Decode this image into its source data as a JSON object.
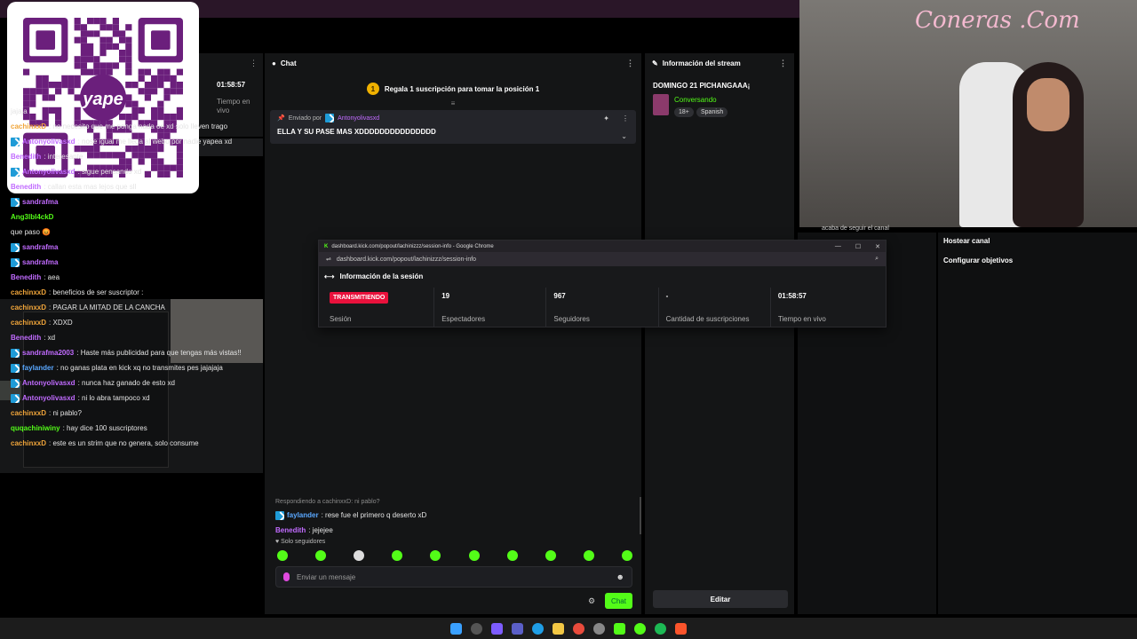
{
  "panels": {
    "chat_title": "Chat",
    "info_title": "Información del stream",
    "menu_glyph": "⋮"
  },
  "left_panel": {
    "time": "01:58:57",
    "label": "Tiempo en vivo"
  },
  "chat": {
    "promo": "Regala 1 suscripción para tomar la posición 1",
    "promo_rank": "1",
    "pinned_by_label": "Enviado por",
    "pinned_by_user": "Antonyolivasxd",
    "pinned_text": "ELLA Y SU PASE MAS XDDDDDDDDDDDDDDD",
    "messages": [
      {
        "user": "",
        "text": "jajaja",
        "color": "#e4e4e4",
        "badge": false
      },
      {
        "user": "cachinxxD",
        "text": ": no necesito que me ponga nada oe xd solo lleven trago",
        "color": "#f0a53a",
        "badge": false
      },
      {
        "user": "Antonyolivasxd",
        "text": ": nose igual me llega al webo por nadie yapea xd",
        "color": "#c16bff",
        "badge": true
      },
      {
        "user": "Benedith",
        "text": ": interesante",
        "color": "#c16bff",
        "badge": false
      },
      {
        "user": "Antonyolivasxd",
        "text": ": sigue pensando xd",
        "color": "#c16bff",
        "badge": true
      },
      {
        "user": "Benedith",
        "text": ": callan esta mas lejos que sll",
        "color": "#c16bff",
        "badge": false
      },
      {
        "user": "sandrafma",
        "text": "",
        "color": "#c16bff",
        "badge": true
      },
      {
        "user": "Ang3lbl4ckD",
        "text": "",
        "color": "#53fc18",
        "badge": false
      },
      {
        "user": "",
        "text": "que paso 😡",
        "color": "#e4e4e4",
        "badge": false
      },
      {
        "user": "sandrafma",
        "text": "",
        "color": "#c16bff",
        "badge": true
      },
      {
        "user": "sandrafma",
        "text": "",
        "color": "#c16bff",
        "badge": true
      },
      {
        "user": "Benedith",
        "text": ": aea",
        "color": "#c16bff",
        "badge": false
      },
      {
        "user": "cachinxxD",
        "text": ": beneficios de ser suscriptor :",
        "color": "#f0a53a",
        "badge": false
      },
      {
        "user": "cachinxxD",
        "text": ": PAGAR LA MITAD DE LA CANCHA",
        "color": "#f0a53a",
        "badge": false
      },
      {
        "user": "cachinxxD",
        "text": ": XDXD",
        "color": "#f0a53a",
        "badge": false
      },
      {
        "user": "Benedith",
        "text": ": xd",
        "color": "#c16bff",
        "badge": false
      },
      {
        "user": "sandrafma2003",
        "text": ": Haste más publicidad para que tengas más vistas!!",
        "color": "#c16bff",
        "badge": true
      },
      {
        "user": "faylander",
        "text": ": no ganas plata en kick xq no transmites pes jajajaja",
        "color": "#5aa8ff",
        "badge": true
      },
      {
        "user": "Antonyolivasxd",
        "text": ": nunca haz ganado de esto xd",
        "color": "#c16bff",
        "badge": true
      },
      {
        "user": "Antonyolivasxd",
        "text": ": ni lo abra tampoco xd",
        "color": "#c16bff",
        "badge": true
      },
      {
        "user": "cachinxxD",
        "text": ": ni pablo?",
        "color": "#f0a53a",
        "badge": false
      },
      {
        "user": "quqachiniwiny",
        "text": ": hay dice 100 suscriptores",
        "color": "#53fc18",
        "badge": false
      },
      {
        "user": "cachinxxD",
        "text": ": este es un strim que no genera, solo consume",
        "color": "#f0a53a",
        "badge": false
      }
    ],
    "reply_hint": "Respondiendo a cachinxxD: ni pablo?",
    "reply_msg": {
      "user": "faylander",
      "text": ": rese fue el primero q deserto xD",
      "color": "#5aa8ff"
    },
    "last_msg": {
      "user": "Benedith",
      "text": ": jejejee",
      "color": "#c16bff"
    },
    "follow_only": "♥ Solo seguidores",
    "input_placeholder": "Enviar un mensaje",
    "send_label": "Chat"
  },
  "stream_info": {
    "title": "DOMINGO 21 PICHANGAAA¡",
    "category": "Conversando",
    "tags": [
      "18+",
      "Spanish"
    ],
    "edit_label": "Editar"
  },
  "right_panel": {
    "toast": "acaba de seguir el canal",
    "links": [
      "Hostear canal",
      "Configurar objetivos"
    ]
  },
  "popup": {
    "window_title": "dashboard.kick.com/popout/lachinizzz/session-info - Google Chrome",
    "url": "dashboard.kick.com/popout/lachinizzz/session-info",
    "section_title": "Información de la sesión",
    "stats": [
      {
        "value": "TRANSMITIENDO",
        "label": "Sesión",
        "live": true
      },
      {
        "value": "19",
        "label": "Espectadores",
        "live": false
      },
      {
        "value": "967",
        "label": "Seguidores",
        "live": false
      },
      {
        "value": "-",
        "label": "Cantidad de suscripciones",
        "live": false
      },
      {
        "value": "01:58:57",
        "label": "Tiempo en vivo",
        "live": false
      }
    ]
  },
  "overlay": {
    "neon_sign": "Coneras .Com",
    "qr_label": "yape"
  },
  "colors": {
    "kick_green": "#53fc18",
    "live_red": "#e9113c",
    "panel": "#141516",
    "yape_purple": "#6b1f7c"
  }
}
